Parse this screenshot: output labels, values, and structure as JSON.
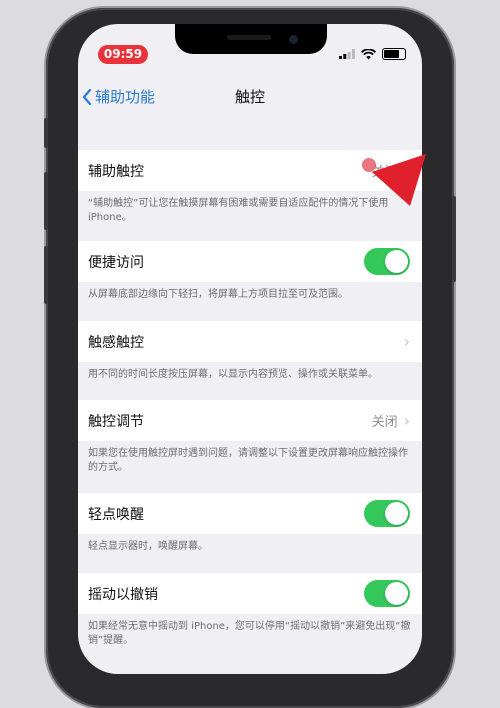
{
  "status_bar": {
    "time": "09:59"
  },
  "nav": {
    "back_label": "辅助功能",
    "title": "触控"
  },
  "settings": [
    {
      "label": "辅助触控",
      "value": "关闭",
      "control": "chevron",
      "footer": "“辅助触控”可让您在触摸屏幕有困难或需要自适应配件的情况下使用iPhone。"
    },
    {
      "label": "便捷访问",
      "control": "toggle",
      "on": true,
      "footer": "从屏幕底部边缘向下轻扫，将屏幕上方项目拉至可及范围。"
    },
    {
      "label": "触感触控",
      "control": "chevron",
      "footer": "用不同的时间长度按压屏幕，以显示内容预览、操作或关联菜单。"
    },
    {
      "label": "触控调节",
      "value": "关闭",
      "control": "chevron",
      "footer": "如果您在使用触控屏时遇到问题，请调整以下设置更改屏幕响应触控操作的方式。"
    },
    {
      "label": "轻点唤醒",
      "control": "toggle",
      "on": true,
      "footer": "轻点显示器时，唤醒屏幕。"
    },
    {
      "label": "摇动以撤销",
      "control": "toggle",
      "on": true,
      "footer": "如果经常无意中摇动到 iPhone，您可以停用“摇动以撤销”来避免出现“撤销”提醒。"
    }
  ],
  "colors": {
    "accent": "#2b7bd6",
    "toggle_on": "#34c759",
    "pointer": "#e0202c",
    "time_pill": "#e8333a"
  }
}
